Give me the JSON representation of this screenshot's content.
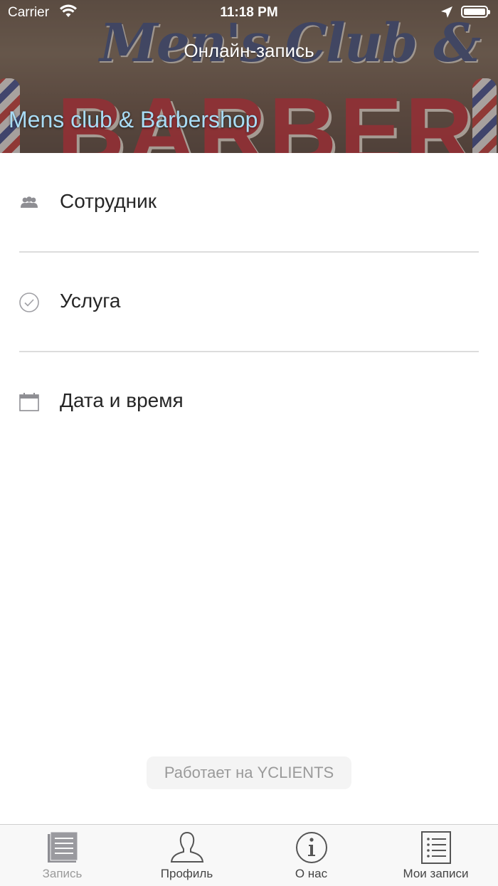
{
  "status_bar": {
    "carrier": "Carrier",
    "time": "11:18 PM"
  },
  "header": {
    "title": "Онлайн-запись",
    "company_name": "Mens club & Barbershop",
    "logo_script": "Men's Club &",
    "logo_big": "BARBER"
  },
  "menu": {
    "items": [
      {
        "label": "Сотрудник",
        "icon": "staff-icon"
      },
      {
        "label": "Услуга",
        "icon": "check-circle-icon"
      },
      {
        "label": "Дата и время",
        "icon": "calendar-icon"
      }
    ]
  },
  "footer": {
    "powered_by": "Работает на YCLIENTS"
  },
  "tabbar": {
    "tabs": [
      {
        "label": "Запись",
        "icon": "booking-icon",
        "active": true
      },
      {
        "label": "Профиль",
        "icon": "profile-icon",
        "active": false
      },
      {
        "label": "О нас",
        "icon": "info-icon",
        "active": false
      },
      {
        "label": "Мои записи",
        "icon": "list-icon",
        "active": false
      }
    ]
  },
  "colors": {
    "company_name": "#a9dcf5",
    "divider": "#dcdcdc",
    "tab_inactive": "#444444",
    "tab_active": "#9a9a9a"
  }
}
